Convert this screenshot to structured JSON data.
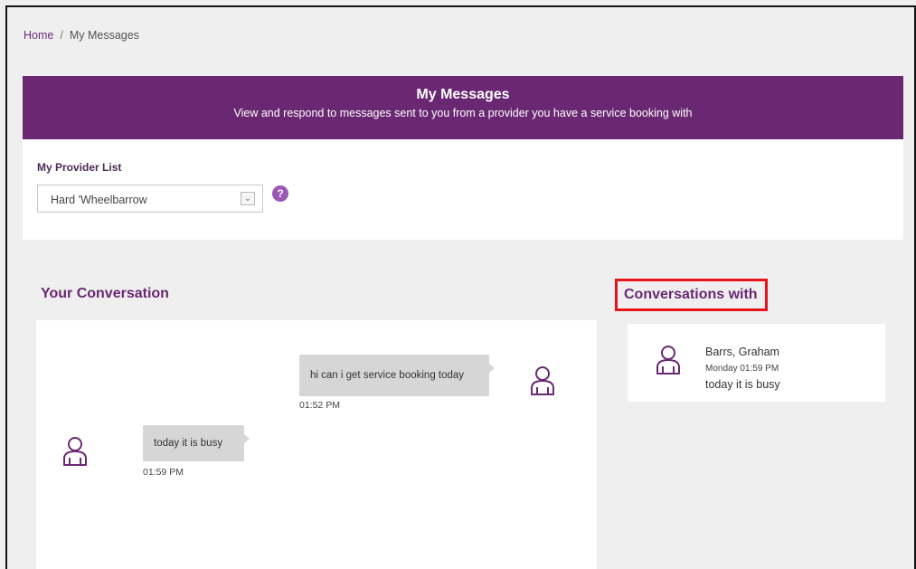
{
  "breadcrumb": {
    "home": "Home",
    "separator": "/",
    "current": "My Messages"
  },
  "banner": {
    "title": "My Messages",
    "subtitle": "View and respond to messages sent to you from a provider you have a service booking with"
  },
  "provider": {
    "label": "My Provider List",
    "selected": "Hard 'Wheelbarrow",
    "help": "?"
  },
  "conversation": {
    "title": "Your Conversation",
    "messages": [
      {
        "text": "hi can i get service booking today",
        "time": "01:52 PM"
      },
      {
        "text": "today it is busy",
        "time": "01:59 PM"
      }
    ]
  },
  "conversations_with": {
    "title": "Conversations with",
    "items": [
      {
        "name": "Barrs, Graham",
        "time": "Monday 01:59 PM",
        "last": "today it is busy"
      }
    ]
  },
  "colors": {
    "brand": "#6a2873",
    "highlight": "#e8141c"
  },
  "icons": {
    "avatar": "person-icon",
    "dropdown": "chevron-down-icon",
    "help": "help-icon"
  }
}
